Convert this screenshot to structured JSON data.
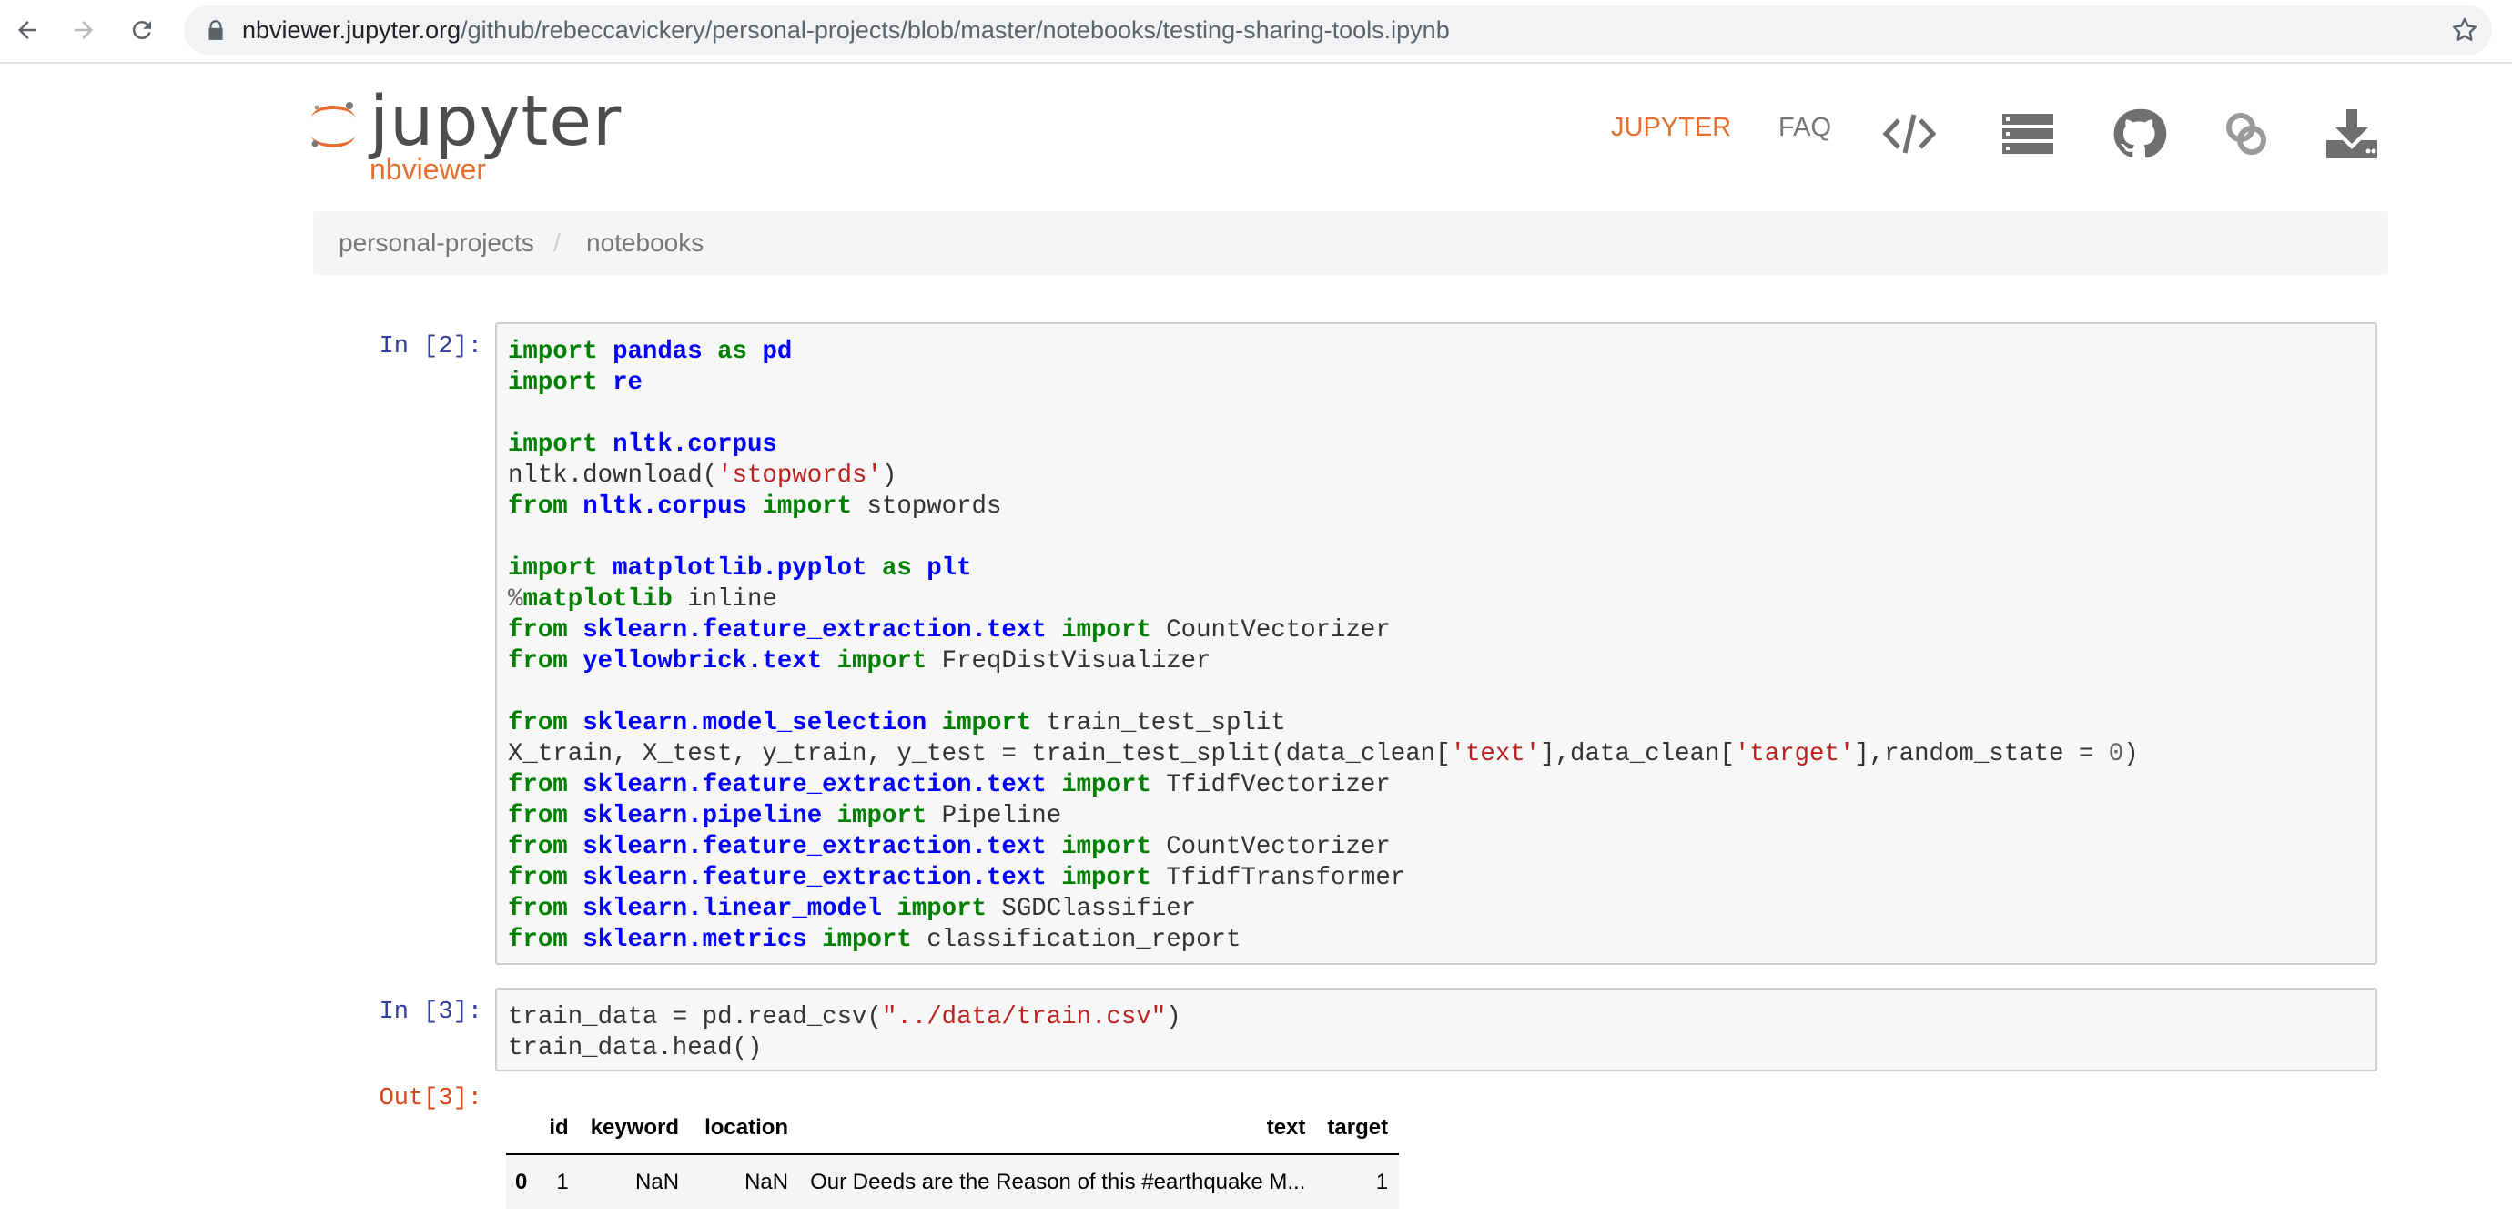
{
  "browser": {
    "url_host": "nbviewer.jupyter.org",
    "url_path": "/github/rebeccavickery/personal-projects/blob/master/notebooks/testing-sharing-tools.ipynb"
  },
  "header": {
    "logo_word": "jupyter",
    "logo_sub": "nbviewer",
    "nav": {
      "jupyter": "JUPYTER",
      "faq": "FAQ"
    },
    "icons": [
      "code-icon",
      "server-icon",
      "github-icon",
      "link-icon",
      "download-icon"
    ]
  },
  "breadcrumb": {
    "items": [
      "personal-projects",
      "notebooks"
    ],
    "separator": "/"
  },
  "cells": [
    {
      "prompt": "In [2]:",
      "lines": [
        [
          [
            "kw",
            "import"
          ],
          [
            "t",
            " "
          ],
          [
            "mod",
            "pandas"
          ],
          [
            "t",
            " "
          ],
          [
            "kw",
            "as"
          ],
          [
            "t",
            " "
          ],
          [
            "mod",
            "pd"
          ]
        ],
        [
          [
            "kw",
            "import"
          ],
          [
            "t",
            " "
          ],
          [
            "mod",
            "re"
          ]
        ],
        [],
        [
          [
            "kw",
            "import"
          ],
          [
            "t",
            " "
          ],
          [
            "mod",
            "nltk.corpus"
          ]
        ],
        [
          [
            "t",
            "nltk.download("
          ],
          [
            "str",
            "'stopwords'"
          ],
          [
            "t",
            ")"
          ]
        ],
        [
          [
            "kw",
            "from"
          ],
          [
            "t",
            " "
          ],
          [
            "mod",
            "nltk.corpus"
          ],
          [
            "t",
            " "
          ],
          [
            "kw",
            "import"
          ],
          [
            "t",
            " stopwords"
          ]
        ],
        [],
        [
          [
            "kw",
            "import"
          ],
          [
            "t",
            " "
          ],
          [
            "mod",
            "matplotlib.pyplot"
          ],
          [
            "t",
            " "
          ],
          [
            "kw",
            "as"
          ],
          [
            "t",
            " "
          ],
          [
            "mod",
            "plt"
          ]
        ],
        [
          [
            "op",
            "%"
          ],
          [
            "magic",
            "matplotlib"
          ],
          [
            "t",
            " inline"
          ]
        ],
        [
          [
            "kw",
            "from"
          ],
          [
            "t",
            " "
          ],
          [
            "mod",
            "sklearn.feature_extraction.text"
          ],
          [
            "t",
            " "
          ],
          [
            "kw",
            "import"
          ],
          [
            "t",
            " CountVectorizer"
          ]
        ],
        [
          [
            "kw",
            "from"
          ],
          [
            "t",
            " "
          ],
          [
            "mod",
            "yellowbrick.text"
          ],
          [
            "t",
            " "
          ],
          [
            "kw",
            "import"
          ],
          [
            "t",
            " FreqDistVisualizer"
          ]
        ],
        [],
        [
          [
            "kw",
            "from"
          ],
          [
            "t",
            " "
          ],
          [
            "mod",
            "sklearn.model_selection"
          ],
          [
            "t",
            " "
          ],
          [
            "kw",
            "import"
          ],
          [
            "t",
            " train_test_split"
          ]
        ],
        [
          [
            "t",
            "X_train, X_test, y_train, y_test = train_test_split(data_clean["
          ],
          [
            "str",
            "'text'"
          ],
          [
            "t",
            "],data_clean["
          ],
          [
            "str",
            "'target'"
          ],
          [
            "t",
            "],random_state = "
          ],
          [
            "num",
            "0"
          ],
          [
            "t",
            ")"
          ]
        ],
        [
          [
            "kw",
            "from"
          ],
          [
            "t",
            " "
          ],
          [
            "mod",
            "sklearn.feature_extraction.text"
          ],
          [
            "t",
            " "
          ],
          [
            "kw",
            "import"
          ],
          [
            "t",
            " TfidfVectorizer"
          ]
        ],
        [
          [
            "kw",
            "from"
          ],
          [
            "t",
            " "
          ],
          [
            "mod",
            "sklearn.pipeline"
          ],
          [
            "t",
            " "
          ],
          [
            "kw",
            "import"
          ],
          [
            "t",
            " Pipeline"
          ]
        ],
        [
          [
            "kw",
            "from"
          ],
          [
            "t",
            " "
          ],
          [
            "mod",
            "sklearn.feature_extraction.text"
          ],
          [
            "t",
            " "
          ],
          [
            "kw",
            "import"
          ],
          [
            "t",
            " CountVectorizer"
          ]
        ],
        [
          [
            "kw",
            "from"
          ],
          [
            "t",
            " "
          ],
          [
            "mod",
            "sklearn.feature_extraction.text"
          ],
          [
            "t",
            " "
          ],
          [
            "kw",
            "import"
          ],
          [
            "t",
            " TfidfTransformer"
          ]
        ],
        [
          [
            "kw",
            "from"
          ],
          [
            "t",
            " "
          ],
          [
            "mod",
            "sklearn.linear_model"
          ],
          [
            "t",
            " "
          ],
          [
            "kw",
            "import"
          ],
          [
            "t",
            " SGDClassifier"
          ]
        ],
        [
          [
            "kw",
            "from"
          ],
          [
            "t",
            " "
          ],
          [
            "mod",
            "sklearn.metrics"
          ],
          [
            "t",
            " "
          ],
          [
            "kw",
            "import"
          ],
          [
            "t",
            " classification_report"
          ]
        ]
      ]
    },
    {
      "prompt": "In [3]:",
      "lines": [
        [
          [
            "t",
            "train_data = pd.read_csv("
          ],
          [
            "str",
            "\"../data/train.csv\""
          ],
          [
            "t",
            ")"
          ]
        ],
        [
          [
            "t",
            "train_data.head()"
          ]
        ]
      ],
      "out_prompt": "Out[3]:"
    }
  ],
  "dataframe": {
    "columns": [
      "",
      "id",
      "keyword",
      "location",
      "text",
      "target"
    ],
    "rows": [
      [
        "0",
        "1",
        "NaN",
        "NaN",
        "Our Deeds are the Reason of this #earthquake M...",
        "1"
      ]
    ]
  }
}
